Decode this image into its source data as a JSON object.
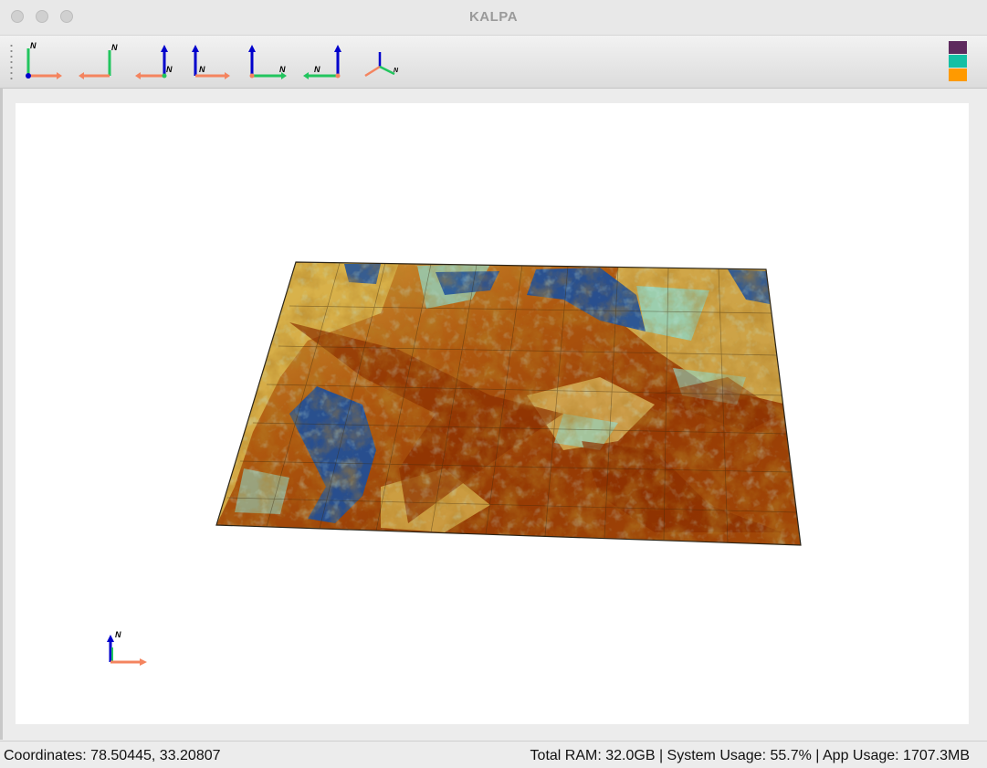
{
  "window": {
    "title": "KALPA"
  },
  "toolbar": {
    "buttons": [
      {
        "name": "view-north-up-left"
      },
      {
        "name": "view-north-up-right"
      },
      {
        "name": "view-north-up-center"
      },
      {
        "name": "view-north-vertical-right"
      },
      {
        "name": "view-north-vertical-east"
      },
      {
        "name": "view-north-vertical-west"
      },
      {
        "name": "view-isometric"
      }
    ],
    "north_label": "N",
    "swatches": [
      "#5e2a5e",
      "#14c0a5",
      "#ff9a00"
    ]
  },
  "colors": {
    "axis_x": "#f4845f",
    "axis_y": "#22c55e",
    "axis_z": "#0000cc",
    "terrain_low": "#1b4f9c",
    "terrain_mid": "#e3c15a",
    "terrain_high": "#8c3000",
    "terrain_cool": "#8fd8c8"
  },
  "status": {
    "coordinates": "Coordinates: 78.50445, 33.20807",
    "system": "Total RAM: 32.0GB | System Usage: 55.7% | App Usage: 1707.3MB"
  }
}
